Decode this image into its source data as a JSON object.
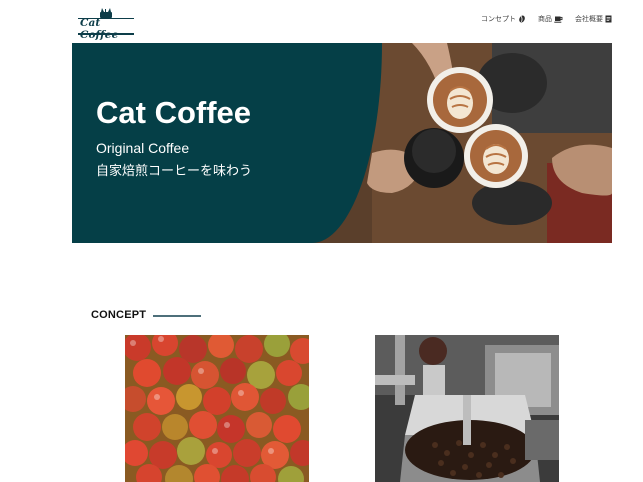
{
  "brand": {
    "name": "Cat Coffee",
    "color": "#0d3d49"
  },
  "nav": {
    "items": [
      {
        "label": "コンセプト",
        "icon": "coffee-bean-icon"
      },
      {
        "label": "商品",
        "icon": "coffee-cup-icon"
      },
      {
        "label": "会社概要",
        "icon": "document-icon"
      }
    ]
  },
  "hero": {
    "title": "Cat Coffee",
    "subtitle": "Original Coffee",
    "tagline": "自家焙煎コーヒーを味わう",
    "panel_color": "#053f47",
    "photo": "hands-toasting-coffee-cups"
  },
  "concept": {
    "heading": "CONCEPT",
    "images": [
      "red-coffee-cherries",
      "coffee-roaster-machine"
    ]
  }
}
